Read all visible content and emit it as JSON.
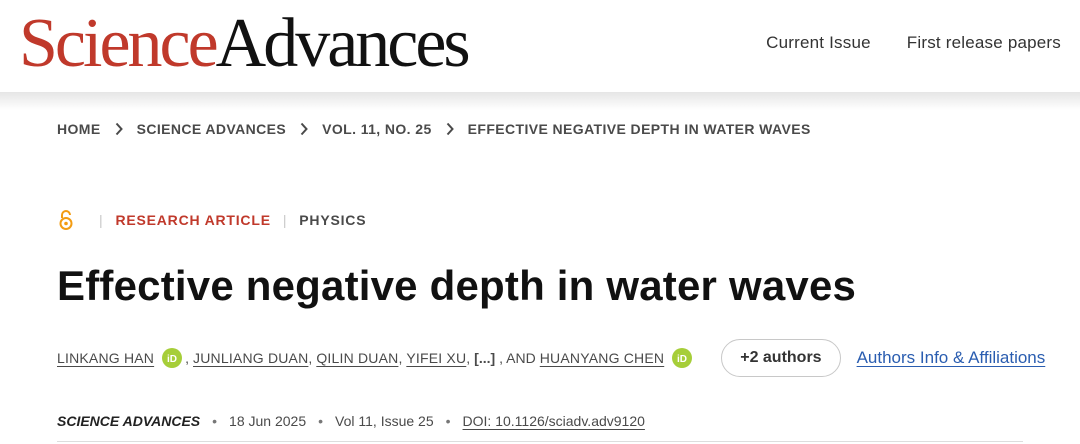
{
  "header": {
    "logo_science": "Science",
    "logo_advances": "Advances",
    "nav": [
      "Current Issue",
      "First release papers"
    ]
  },
  "breadcrumb": [
    "HOME",
    "SCIENCE ADVANCES",
    "VOL. 11, NO. 25",
    "EFFECTIVE NEGATIVE DEPTH IN WATER WAVES"
  ],
  "article": {
    "access_icon": "open-access-icon",
    "type": "RESEARCH ARTICLE",
    "subject": "PHYSICS",
    "title": "Effective negative depth in water waves"
  },
  "authors": {
    "list": [
      "LINKANG HAN",
      "JUNLIANG DUAN",
      "QILIN DUAN",
      "YIFEI XU",
      "HUANYANG CHEN"
    ],
    "separator": ",",
    "ellipsis": "[...]",
    "and": ", AND",
    "more_button": "+2 authors",
    "info_link": "Authors Info & Affiliations"
  },
  "citation": {
    "journal": "SCIENCE ADVANCES",
    "date": "18 Jun 2025",
    "volume": "Vol 11, Issue 25",
    "doi": "DOI: 10.1126/sciadv.adv9120"
  },
  "colors": {
    "brand_red": "#c0392b",
    "link_blue": "#2a5db0",
    "orcid_green": "#a6ce39",
    "open_access_orange": "#f39c12"
  }
}
